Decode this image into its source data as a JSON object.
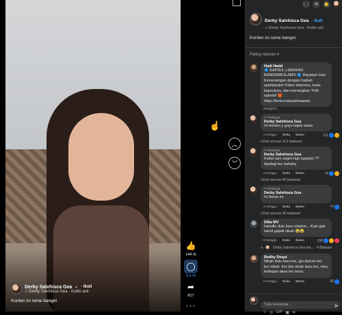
{
  "video": {
    "author": "Derby Salvhisca Gea",
    "verified_glyph": "✓",
    "follow_label": "Ikuti",
    "audio": "Derby Salvhisca Gea · Audio asli",
    "caption": "Konten ini rame banget"
  },
  "actions": {
    "like_count": "144 rb",
    "comment_count": "5,6 rb",
    "share_count": "817"
  },
  "panel": {
    "author": "Derby Salvhisca Gea",
    "follow_label": "· Ikuti",
    "audio": "Derby Salvhisca Gea · Audio asli",
    "caption": "Konten ini rame banget",
    "sort_label": "Paling relevan ▾"
  },
  "comments": [
    {
      "author": "Hadi Hadd",
      "text": "🔷 KAPSUL LEBARAN BANDARBOLA855 🔷 Rayakan Hari Kemenangan dengan hadiah spektakuler! Klaim tokenmu, buka kapsulnya, dan menangkan THR spesial! 🎁 https://bola.ms/pastimaswin",
      "see_more": "Mengirim..."
    },
    {
      "tag": "Pembuat",
      "author": "Derby Salvhisca Gea",
      "text": "Ini konten y guys baper awas",
      "time": "9 minggu",
      "like_label": "Suka",
      "reply_label": "Balas",
      "reaction_count": "111",
      "replies": "Lihat semua 113 balasan"
    },
    {
      "tag": "Pembuat",
      "author": "Derby Salvhisca Gea",
      "text": "Kalian jam segini lagi ngapain ?? Apalagi tes hahaha",
      "time": "9 minggu",
      "like_label": "Suka",
      "reply_label": "Balas",
      "reaction_count": "78",
      "replies": "Lihat semua 43 balasan"
    },
    {
      "tag": "Pembuat",
      "author": "Derby Salvhisca Gea",
      "text": "Ini benar ini",
      "time": "9 minggu",
      "like_label": "Suka",
      "reply_label": "Balas",
      "reaction_count": "74",
      "replies": "Lihat semua 36 balasan"
    },
    {
      "author": "Dika MV",
      "text": "Hamilin dulu baru nikahin... Kalo gak hamil gajadi nikah 😂😂",
      "time": "9 minggu",
      "like_label": "Suka",
      "reply_label": "Balas",
      "reaction_count": "198",
      "reply_preview": "Derby Salvhisca Gea me... · 4 Balasan"
    },
    {
      "author": "Redhy Dequi",
      "text": "Nikah dulu baru tes, jgn duluan tes bru nikah. Km klw nikah baru tes, mka kedepan akan tes terus.",
      "time": "9 minggu",
      "like_label": "Suka",
      "reply_label": "Balas",
      "reaction_count": "86"
    }
  ],
  "composer": {
    "placeholder": "Tulis komentar...",
    "tools": [
      "☺",
      "◎",
      "GIF",
      "▣",
      "✦"
    ]
  },
  "topbar_icons": [
    "apps-grid-icon",
    "messenger-icon",
    "bell-icon",
    "profile-avatar"
  ]
}
